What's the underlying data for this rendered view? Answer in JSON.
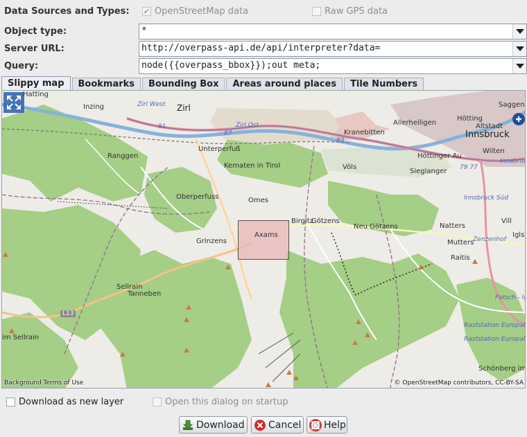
{
  "data_sources": {
    "label": "Data Sources and Types:",
    "osm_checkbox": {
      "label": "OpenStreetMap data",
      "checked": true,
      "check_glyph": "✔"
    },
    "gps_checkbox": {
      "label": "Raw GPS data",
      "checked": false
    }
  },
  "object_type": {
    "label": "Object type:",
    "value": "*"
  },
  "server_url": {
    "label": "Server URL:",
    "value": "http://overpass-api.de/api/interpreter?data="
  },
  "query": {
    "label": "Query:",
    "value": "node({{overpass_bbox}});out meta;"
  },
  "tabs": [
    {
      "label": "Slippy map",
      "active": true
    },
    {
      "label": "Bookmarks",
      "active": false
    },
    {
      "label": "Bounding Box",
      "active": false
    },
    {
      "label": "Areas around places",
      "active": false
    },
    {
      "label": "Tile Numbers",
      "active": false
    }
  ],
  "map": {
    "places": {
      "hatting": "Hatting",
      "zirl": "Zirl",
      "inzing": "Inzing",
      "zirl_west": "Zirl West",
      "zirl_west_num": "91",
      "zirl_ost": "Zirl Ost",
      "zirl_ost_num": "87",
      "num_83": "83",
      "kranebitten": "Kranebitten",
      "allerheiligen": "Allerheiligen",
      "hoetting": "Hötting",
      "altstadt": "Altstadt",
      "saggen": "Saggen",
      "innsbruck": "Innsbruck",
      "wilten": "Wilten",
      "unterperfuss": "Unterperfuß",
      "ranggen": "Ranggen",
      "kematen": "Kematen in Tirol",
      "hoettinger_au": "Höttinger Au",
      "voels": "Völs",
      "sieglanger": "Sieglanger",
      "num_79_77": "79 77",
      "innsbruck_w": "Innsbruck W",
      "oberperfuss": "Oberperfuss",
      "omes": "Omes",
      "innsbruck_sued": "Innsbruck Süd",
      "birgitz": "Birgitz",
      "goetzens": "Götzens",
      "neu_goetzens": "Neu Götzens",
      "natters": "Natters",
      "vill": "Vill",
      "grinzens": "Grinzens",
      "axams": "Axams",
      "igls": "Igls",
      "zenzenhof": "Zenzenhof",
      "mutters": "Mutters",
      "raitis": "Raitis",
      "sellrain": "Sellrain",
      "tanneben": "Tanneben",
      "patsch": "Patsch - Igls",
      "l13": "L13",
      "rast_1": "Raststation Europabrück",
      "rast_2": "Raststation Europabrück",
      "im_sellrain": "im Sellrain",
      "schoenberg": "Schönberg im Stu"
    },
    "attribution_left": "Background Terms of Use",
    "attribution_right": "© OpenStreetMap contributors, CC-BY-SA",
    "selection_area": "Axams"
  },
  "options": {
    "new_layer": {
      "label": "Download as new layer",
      "checked": false
    },
    "startup": {
      "label": "Open this dialog on startup",
      "checked": false
    }
  },
  "buttons": {
    "download": "Download",
    "cancel": "Cancel",
    "help": "Help"
  },
  "colors": {
    "accent": "#2b6fc2",
    "selection_fill": "#e9b7b7",
    "forest": "#a5ce86"
  }
}
